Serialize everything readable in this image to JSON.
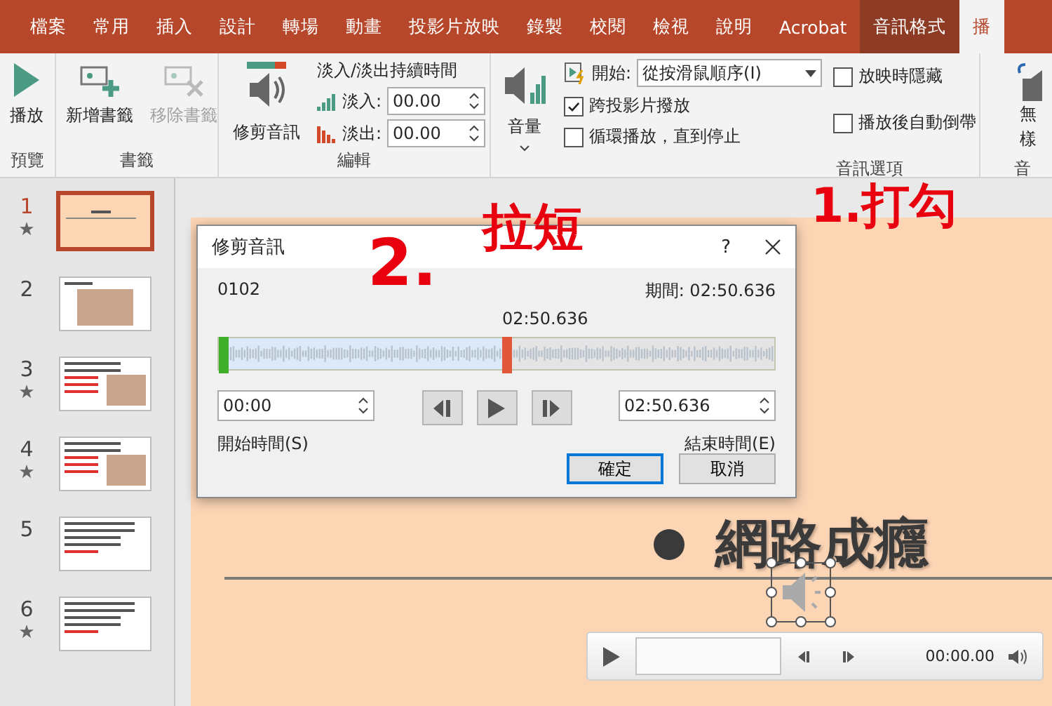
{
  "tabs": [
    {
      "label": "檔案",
      "selected": false,
      "contextual": false
    },
    {
      "label": "常用",
      "selected": false,
      "contextual": false
    },
    {
      "label": "插入",
      "selected": false,
      "contextual": false
    },
    {
      "label": "設計",
      "selected": false,
      "contextual": false
    },
    {
      "label": "轉場",
      "selected": false,
      "contextual": false
    },
    {
      "label": "動畫",
      "selected": false,
      "contextual": false
    },
    {
      "label": "投影片放映",
      "selected": false,
      "contextual": false
    },
    {
      "label": "錄製",
      "selected": false,
      "contextual": false
    },
    {
      "label": "校閱",
      "selected": false,
      "contextual": false
    },
    {
      "label": "檢視",
      "selected": false,
      "contextual": false
    },
    {
      "label": "說明",
      "selected": false,
      "contextual": false
    },
    {
      "label": "Acrobat",
      "selected": false,
      "contextual": false
    },
    {
      "label": "音訊格式",
      "selected": false,
      "contextual": true
    },
    {
      "label": "播",
      "selected": true,
      "contextual": false
    }
  ],
  "ribbon": {
    "preview": {
      "play_button": "播放",
      "label": "預覽"
    },
    "bookmarks": {
      "buttons": [
        {
          "label": "新增書籤",
          "disabled": false
        },
        {
          "label": "移除書籤",
          "disabled": true
        }
      ],
      "label": "書籤"
    },
    "editing": {
      "trim_button": "修剪音訊",
      "fade_title": "淡入/淡出持續時間",
      "fades": [
        {
          "label": "淡入:",
          "value": "00.00"
        },
        {
          "label": "淡出:",
          "value": "00.00"
        }
      ],
      "label": "編輯"
    },
    "audio_options": {
      "volume_button": "音量",
      "start": {
        "label": "開始:",
        "value": "從按滑鼠順序(I)"
      },
      "checkboxes": [
        {
          "label": "跨投影片撥放",
          "checked": true
        },
        {
          "label": "循環播放，直到停止",
          "checked": false
        },
        {
          "label": "放映時隱藏",
          "checked": false
        },
        {
          "label": "播放後自動倒帶",
          "checked": false
        }
      ],
      "label": "音訊選項"
    },
    "styles": {
      "button_lines": [
        "無",
        "樣"
      ],
      "label": "音"
    }
  },
  "slides": [
    {
      "number": "1",
      "selected": true,
      "animated": true,
      "kind": "title"
    },
    {
      "number": "2",
      "selected": false,
      "animated": false,
      "kind": "pictures"
    },
    {
      "number": "3",
      "selected": false,
      "animated": true,
      "kind": "mixed"
    },
    {
      "number": "4",
      "selected": false,
      "animated": true,
      "kind": "mixed"
    },
    {
      "number": "5",
      "selected": false,
      "animated": false,
      "kind": "text"
    },
    {
      "number": "6",
      "selected": false,
      "animated": true,
      "kind": "text"
    }
  ],
  "dialog": {
    "title": "修剪音訊",
    "help": "?",
    "file_name": "0102",
    "duration": "期間: 02:50.636",
    "start_marker": {
      "level": 0
    },
    "end_marker": {
      "level": 0.51,
      "time": "02:50.636"
    },
    "start_time": {
      "value": "00:00",
      "label": "開始時間(S)"
    },
    "end_time": {
      "value": "02:50.636",
      "label": "結束時間(E)"
    },
    "buttons": [
      {
        "label": "確定",
        "default": true
      },
      {
        "label": "取消",
        "default": false
      }
    ]
  },
  "slide": {
    "bullet_text": "網路成癮",
    "player": {
      "time": "00:00.00"
    }
  },
  "annotations": [
    {
      "text": "1.打勾"
    },
    {
      "text": "2."
    },
    {
      "text": "拉短"
    }
  ]
}
